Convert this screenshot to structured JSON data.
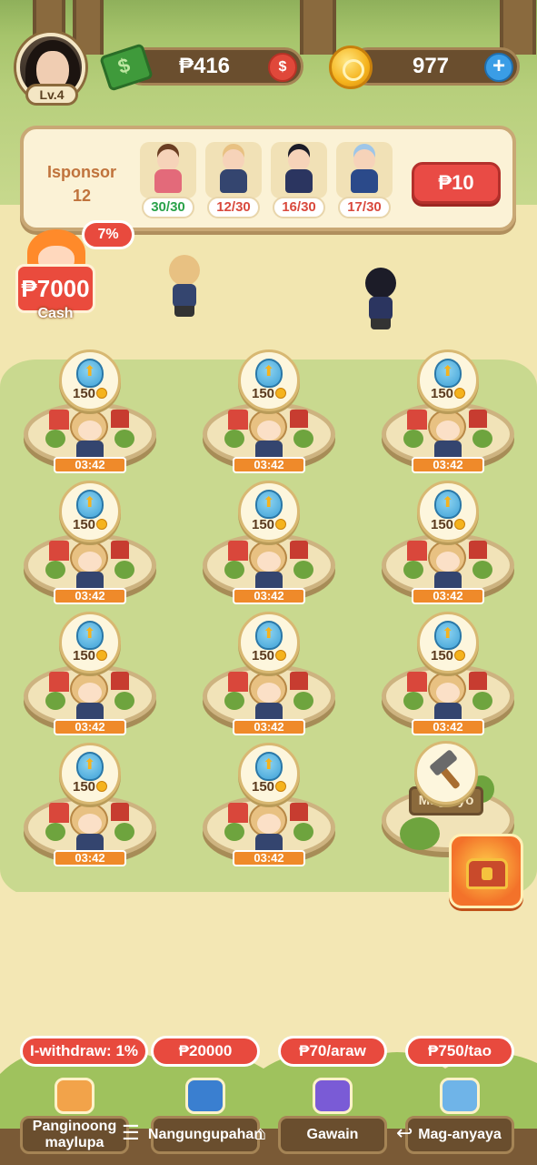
{
  "player": {
    "level": "Lv.4"
  },
  "currency": {
    "peso": "₱416",
    "coins": "977"
  },
  "sponsor": {
    "label_line1": "Isponsor",
    "label_line2": "12",
    "slots": [
      {
        "count": "30/30",
        "count_color": "#2aa24a",
        "body_color": "#e36a7a",
        "hair_color": "#6b3e22"
      },
      {
        "count": "12/30",
        "count_color": "#d94a3e",
        "body_color": "#34456f",
        "hair_color": "#e8c182"
      },
      {
        "count": "16/30",
        "count_color": "#d94a3e",
        "body_color": "#2b3560",
        "hair_color": "#1c1c28"
      },
      {
        "count": "17/30",
        "count_color": "#d94a3e",
        "body_color": "#2b4a8a",
        "hair_color": "#9ec6e8"
      }
    ],
    "button": "₱10"
  },
  "cash_bonus": {
    "percent": "7%",
    "amount": "₱7000",
    "label": "Cash"
  },
  "plots": [
    {
      "cost": "150",
      "timer": "03:42"
    },
    {
      "cost": "150",
      "timer": "03:42"
    },
    {
      "cost": "150",
      "timer": "03:42"
    },
    {
      "cost": "150",
      "timer": "03:42"
    },
    {
      "cost": "150",
      "timer": "03:42"
    },
    {
      "cost": "150",
      "timer": "03:42"
    },
    {
      "cost": "150",
      "timer": "03:42"
    },
    {
      "cost": "150",
      "timer": "03:42"
    },
    {
      "cost": "150",
      "timer": "03:42"
    },
    {
      "cost": "150",
      "timer": "03:42"
    },
    {
      "cost": "150",
      "timer": "03:42"
    }
  ],
  "builder": {
    "sign": "Magtayo"
  },
  "nav": [
    {
      "badge": "I-withdraw: 1%",
      "label": "Panginoong maylupa",
      "icon": "shop-icon"
    },
    {
      "badge": "₱20000",
      "label": "Nangungupahan",
      "icon": "tenant-icon"
    },
    {
      "badge": "₱70/araw",
      "label": "Gawain",
      "icon": "calendar-check-icon"
    },
    {
      "badge": "₱750/tao",
      "label": "Mag-anyaya",
      "icon": "invite-hand-icon"
    }
  ],
  "system_nav": {
    "menu": "☰",
    "home": "⌂",
    "back": "↩"
  },
  "colors": {
    "accent_red": "#e84a3e",
    "board_brown": "#6a4e2e",
    "timer_orange": "#ef8a2a"
  }
}
